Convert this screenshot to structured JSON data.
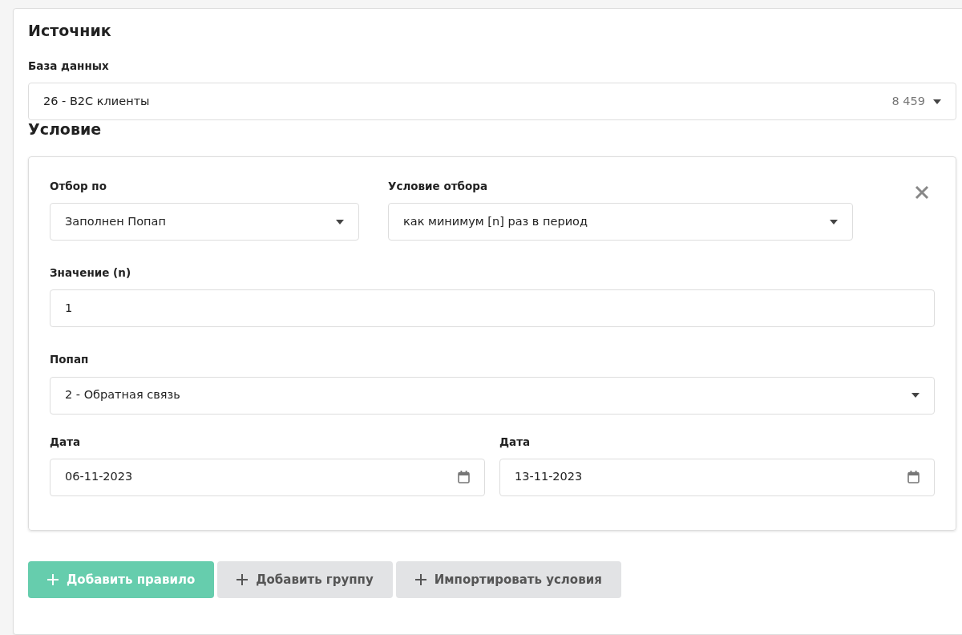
{
  "source": {
    "title": "Источник",
    "database": {
      "label": "База данных",
      "value": "26 - B2C клиенты",
      "count": "8 459"
    }
  },
  "condition": {
    "title": "Условие",
    "rule": {
      "rows": [
        {
          "fields": [
            {
              "kind": "select",
              "label": "Отбор по",
              "value": "Заполнен Попап"
            },
            {
              "kind": "select",
              "label": "Условие отбора",
              "value": "как минимум [n] раз в период"
            }
          ]
        },
        {
          "fields": [
            {
              "kind": "input",
              "label": "Значение (n)",
              "value": "1"
            }
          ]
        },
        {
          "fields": [
            {
              "kind": "select",
              "label": "Попап",
              "value": "2 - Обратная связь"
            }
          ]
        },
        {
          "fields": [
            {
              "kind": "date",
              "label": "Дата",
              "value": "06-11-2023"
            },
            {
              "kind": "date",
              "label": "Дата",
              "value": "13-11-2023"
            }
          ]
        }
      ]
    }
  },
  "buttons": [
    {
      "kind": "primary",
      "label": "Добавить правило"
    },
    {
      "kind": "secondary",
      "label": "Добавить группу"
    },
    {
      "kind": "secondary",
      "label": "Импортировать условия"
    }
  ]
}
